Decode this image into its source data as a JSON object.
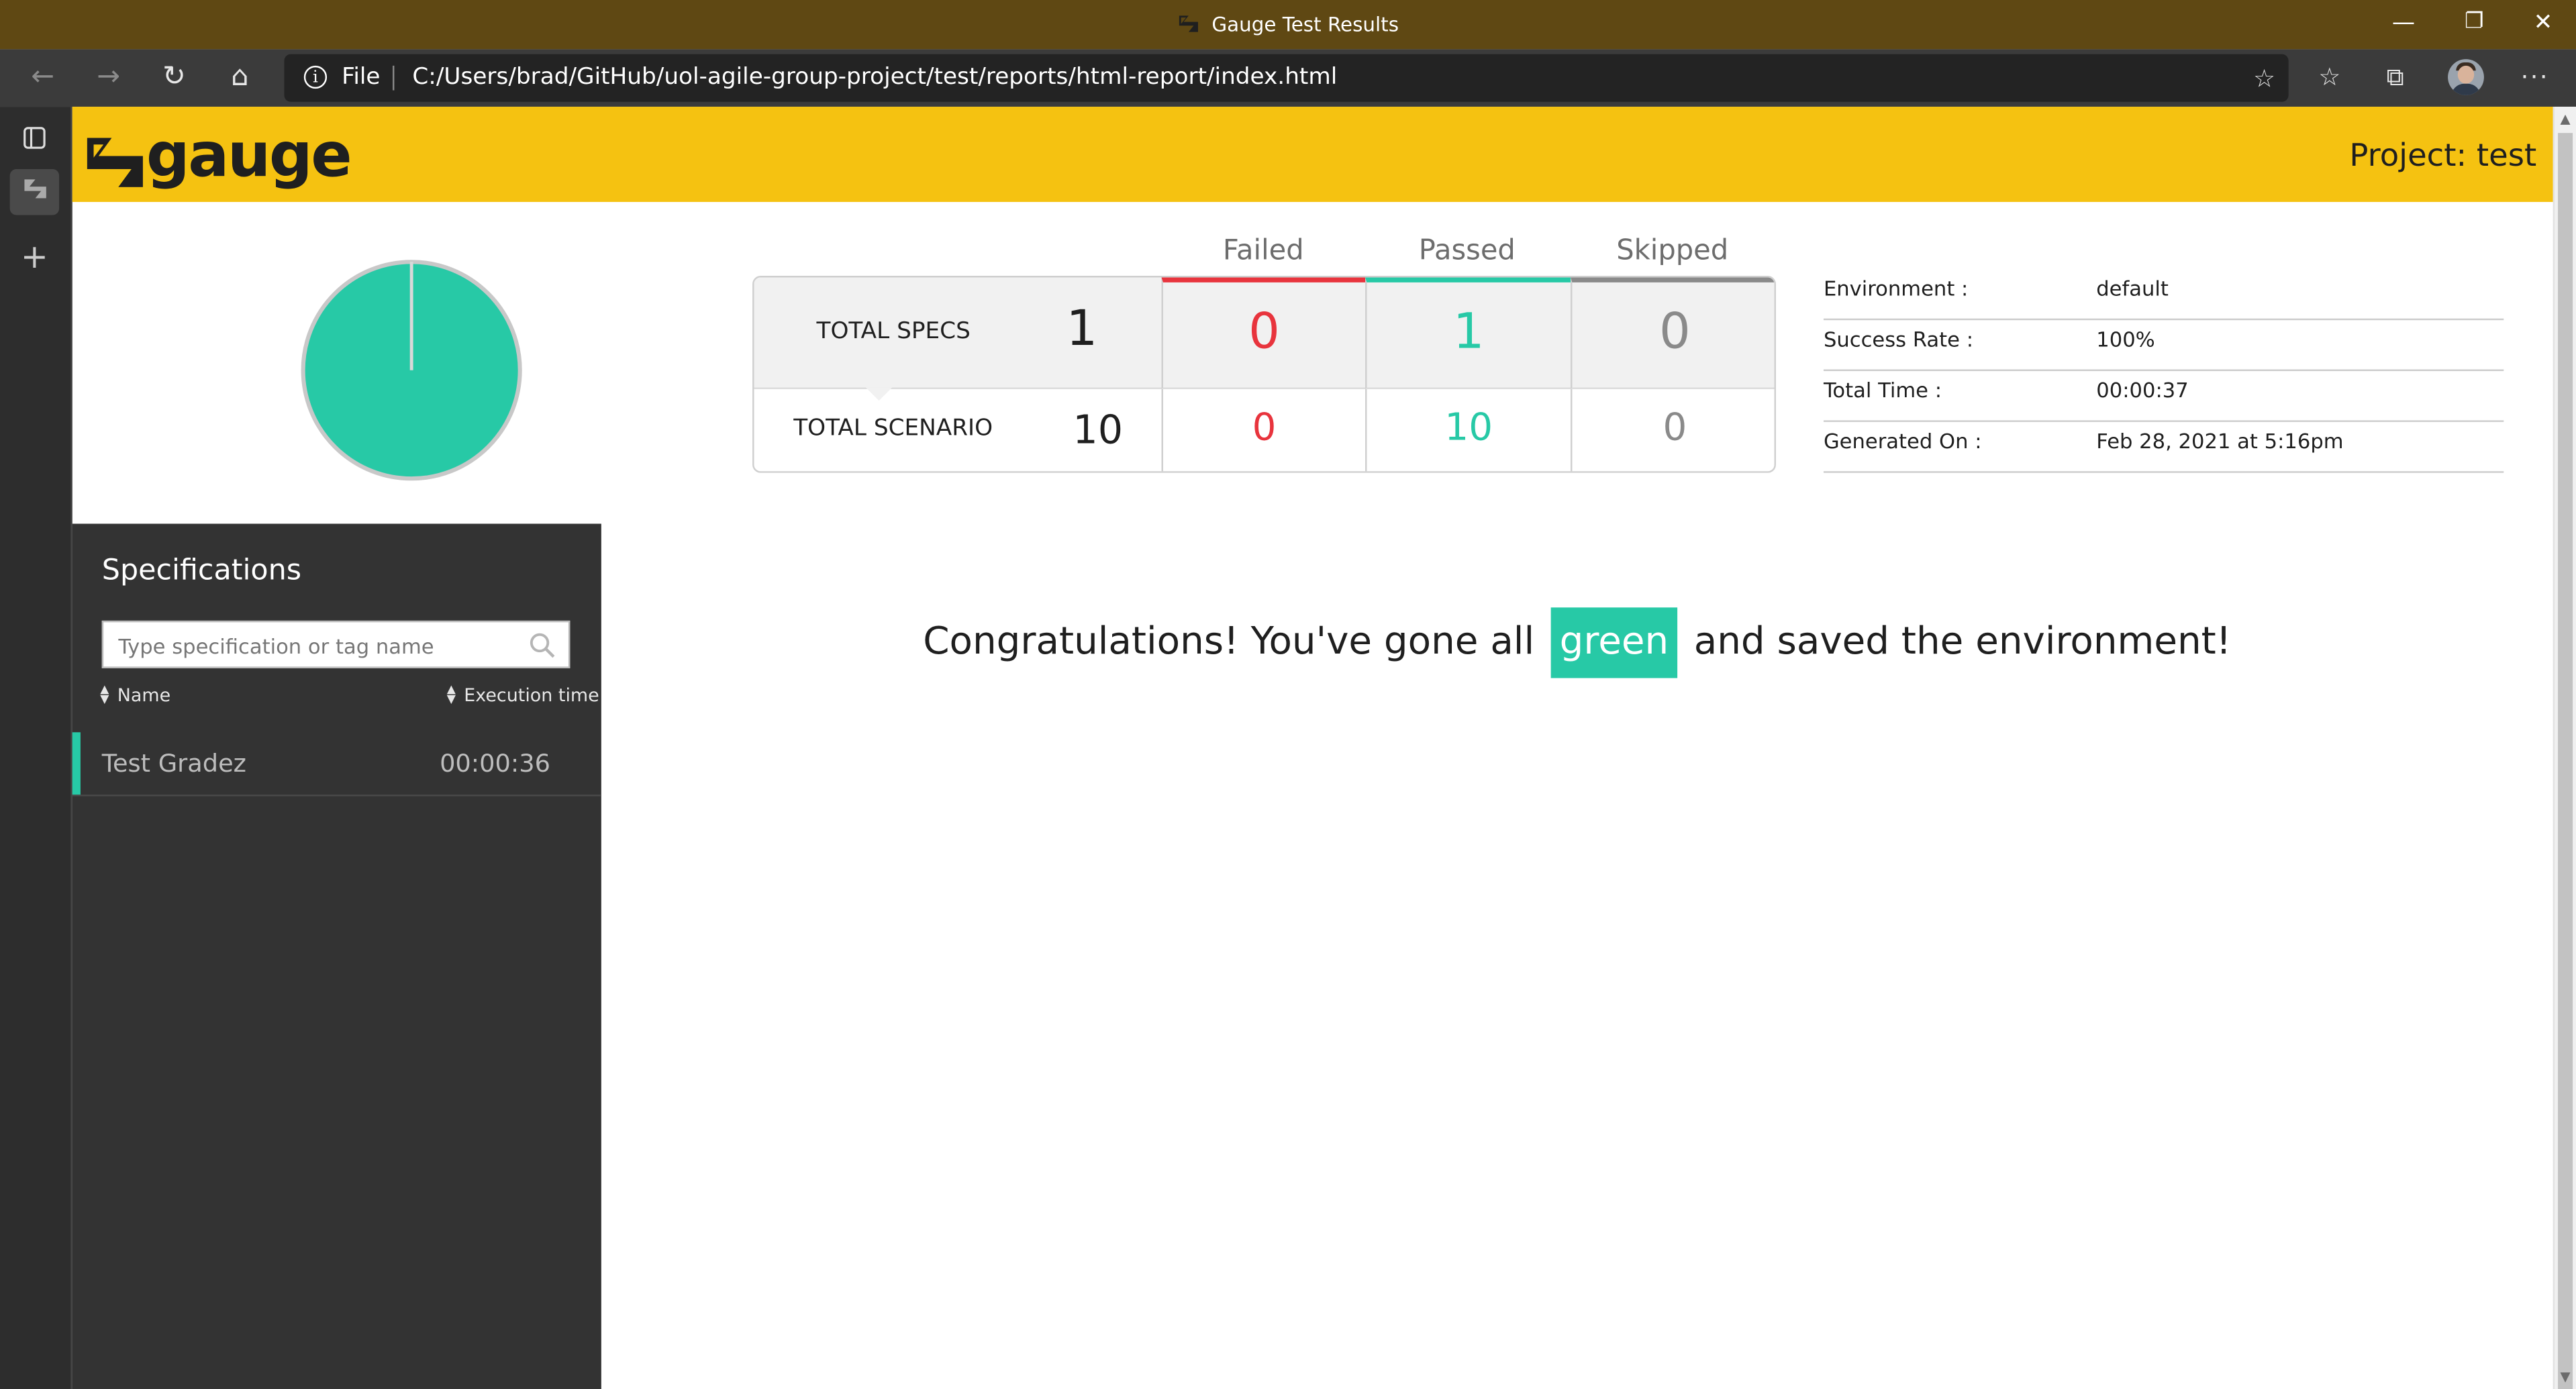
{
  "window": {
    "title": "Gauge Test Results",
    "minimize": "—",
    "restore": "❐",
    "close": "✕"
  },
  "browser": {
    "back_icon": "←",
    "forward_icon": "→",
    "refresh_icon": "↻",
    "home_icon": "⌂",
    "info_icon": "i",
    "protocol_label": "File",
    "url": "C:/Users/brad/GitHub/uol-agile-group-project/test/reports/html-report/index.html",
    "add_favorite_icon": "☆",
    "favorites_icon": "☆",
    "collections_icon": "⧉",
    "more_icon": "···"
  },
  "vertical_tabs": {
    "new_tab_icon": "+"
  },
  "header": {
    "logo_text": "gauge",
    "project_label": "Project: test"
  },
  "summary": {
    "columns": [
      "Failed",
      "Passed",
      "Skipped"
    ],
    "rows": [
      {
        "label": "TOTAL SPECS",
        "total": "1",
        "failed": "0",
        "passed": "1",
        "skipped": "0"
      },
      {
        "label": "TOTAL SCENARIO",
        "total": "10",
        "failed": "0",
        "passed": "10",
        "skipped": "0"
      }
    ],
    "colors": {
      "failed": "#e8343d",
      "passed": "#27c9a6",
      "skipped": "#8a8a8a"
    }
  },
  "pie": {
    "passed_fraction": 1.0,
    "color": "#27c9a6"
  },
  "environment": [
    {
      "key": "Environment :",
      "value": "default"
    },
    {
      "key": "Success Rate :",
      "value": "100%"
    },
    {
      "key": "Total Time :",
      "value": "00:00:37"
    },
    {
      "key": "Generated On :",
      "value": "Feb 28, 2021 at 5:16pm"
    }
  ],
  "sidebar": {
    "title": "Specifications",
    "search_placeholder": "Type specification or tag name",
    "sort_name": "Name",
    "sort_time": "Execution time",
    "specs": [
      {
        "name": "Test Gradez",
        "time": "00:00:36"
      }
    ]
  },
  "message": {
    "before": "Congratulations! You've gone all",
    "highlight": "green",
    "after": "and saved the environment!"
  }
}
